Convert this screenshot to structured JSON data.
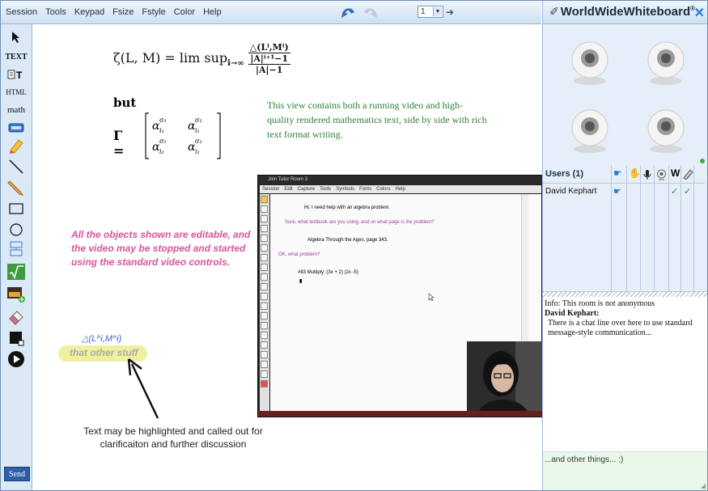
{
  "menu": [
    "Session",
    "Tools",
    "Keypad",
    "Fsize",
    "Fstyle",
    "Color",
    "Help"
  ],
  "page_selector": {
    "value": "1"
  },
  "brand": {
    "name": "WorldWideWhiteboard",
    "reg": "®"
  },
  "toolbar": {
    "text_label": "TEXT",
    "html_label": "HTML",
    "math_label": "math",
    "send_label": "Send"
  },
  "board": {
    "math_line1": {
      "lhs": "ζ(L, M) = lim sup",
      "sub": "i→∞",
      "num": "△(Lⁱ,Mⁱ)",
      "den_top": "|A|ⁱ⁺¹−1",
      "den_bottom": "|A|−1"
    },
    "but_word": "but",
    "gamma_eq": "Γ =",
    "matrix": [
      [
        "α_{i₁}^{σ₁}",
        "α_{i₁}^{σ₂}"
      ],
      [
        "α_{i₂}^{σ₁}",
        "α_{i₂}^{σ₂}"
      ]
    ],
    "green_text": "This view contains both a running video and high-quality rendered mathematics text, side by side with rich text format writing.",
    "pink_text": "All the objects shown are editable, and the video may be stopped and started using the standard video controls.",
    "delta_label": "△(L^i,M^i)",
    "highlight_text": "that other stuff",
    "callout_text": "Text may be highlighted and called out for clarificaiton and further discussion"
  },
  "video": {
    "title": "Join Tutor Room 3",
    "menu": [
      "Session",
      "Edit",
      "Capture",
      "Tools",
      "Symbols",
      "Fonts",
      "Colors",
      "Help"
    ],
    "lines": [
      {
        "text": "Hi. I need help with an algebra problem.",
        "color": "#222222"
      },
      {
        "text": "Sure, what textbook are you using, and on what page is the problem?",
        "color": "#a23a9a"
      },
      {
        "text": "Algebra Through the Ages, page 343.",
        "color": "#222222"
      },
      {
        "text": "OK, what problem?",
        "color": "#a23a9a"
      },
      {
        "text": "#83 Multiply: (3x + 2) (2x -5)",
        "color": "#222222"
      }
    ]
  },
  "users": {
    "header": "Users (1)",
    "rows": [
      {
        "name": "David Kephart"
      }
    ],
    "w_label": "W",
    "check": "✓"
  },
  "chat": {
    "info": "Info: This room is not anonymous",
    "author": "David Kephart:",
    "message": "There is a chat line over here to use standard message-style communication...",
    "input": "...and other things... :)"
  }
}
